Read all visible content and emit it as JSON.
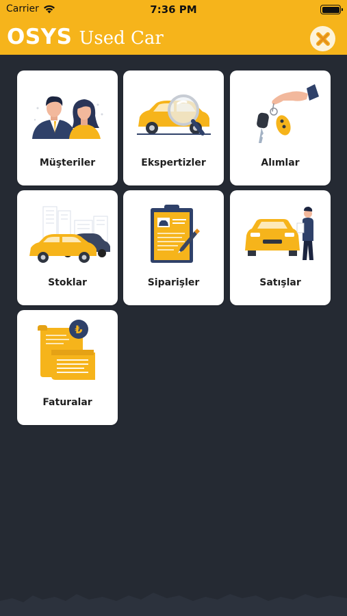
{
  "status_bar": {
    "carrier": "Carrier",
    "time": "7:36 PM"
  },
  "header": {
    "brand_bold": "OSYS",
    "brand_light": "Used Car",
    "close_icon": "close-x-icon"
  },
  "colors": {
    "header": "#f6b41b",
    "background": "#252a33",
    "tile": "#ffffff",
    "accent": "#f6b41b",
    "navy": "#2f4169"
  },
  "menu": {
    "items": [
      {
        "label": "Müşteriler",
        "icon": "customers-icon"
      },
      {
        "label": "Ekspertizler",
        "icon": "expertise-icon"
      },
      {
        "label": "Alımlar",
        "icon": "purchases-icon"
      },
      {
        "label": "Stoklar",
        "icon": "stock-icon"
      },
      {
        "label": "Siparişler",
        "icon": "orders-icon"
      },
      {
        "label": "Satışlar",
        "icon": "sales-icon"
      },
      {
        "label": "Faturalar",
        "icon": "invoices-icon"
      }
    ]
  }
}
